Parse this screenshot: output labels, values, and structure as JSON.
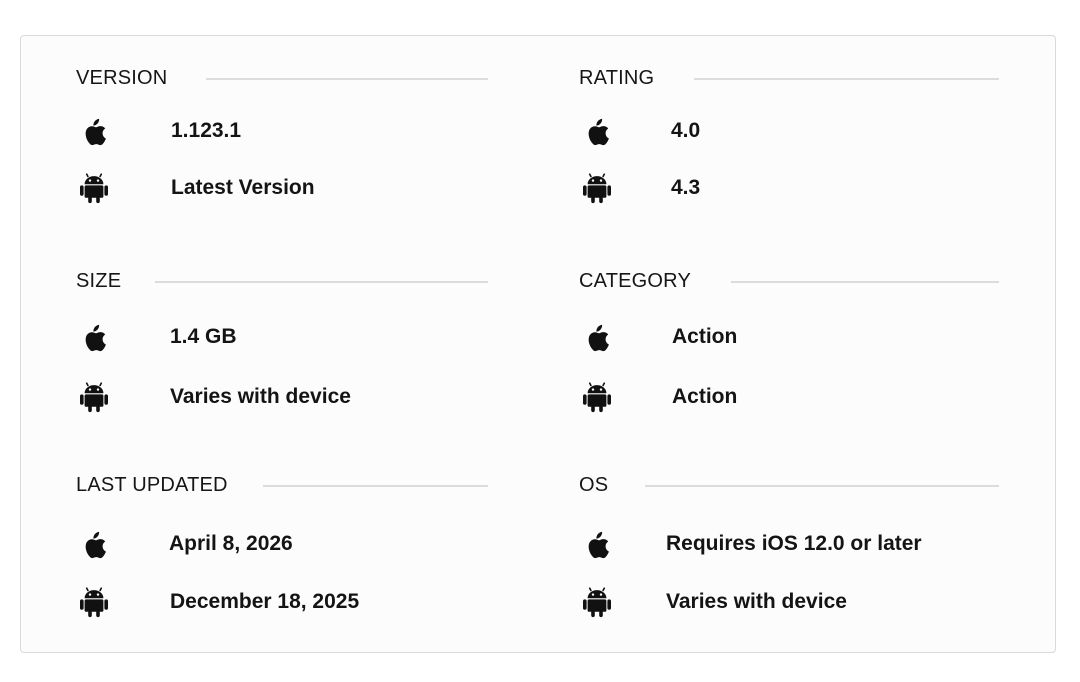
{
  "sections": {
    "version": {
      "title": "VERSION",
      "ios": "1.123.1",
      "android": "Latest Version"
    },
    "rating": {
      "title": "RATING",
      "ios": "4.0",
      "android": "4.3"
    },
    "size": {
      "title": "SIZE",
      "ios": "1.4 GB",
      "android": "Varies with device"
    },
    "category": {
      "title": "CATEGORY",
      "ios": "Action",
      "android": "Action"
    },
    "last_updated": {
      "title": "LAST UPDATED",
      "ios": "April 8, 2026",
      "android": "December 18, 2025"
    },
    "os": {
      "title": "OS",
      "ios": "Requires iOS 12.0 or later",
      "android": "Varies with device"
    }
  },
  "icons": {
    "ios": "apple-icon",
    "android": "android-icon"
  },
  "colors": {
    "icon": "#111111",
    "text": "#141414",
    "rule": "#dcdcdc",
    "border": "#d9d9d9"
  }
}
